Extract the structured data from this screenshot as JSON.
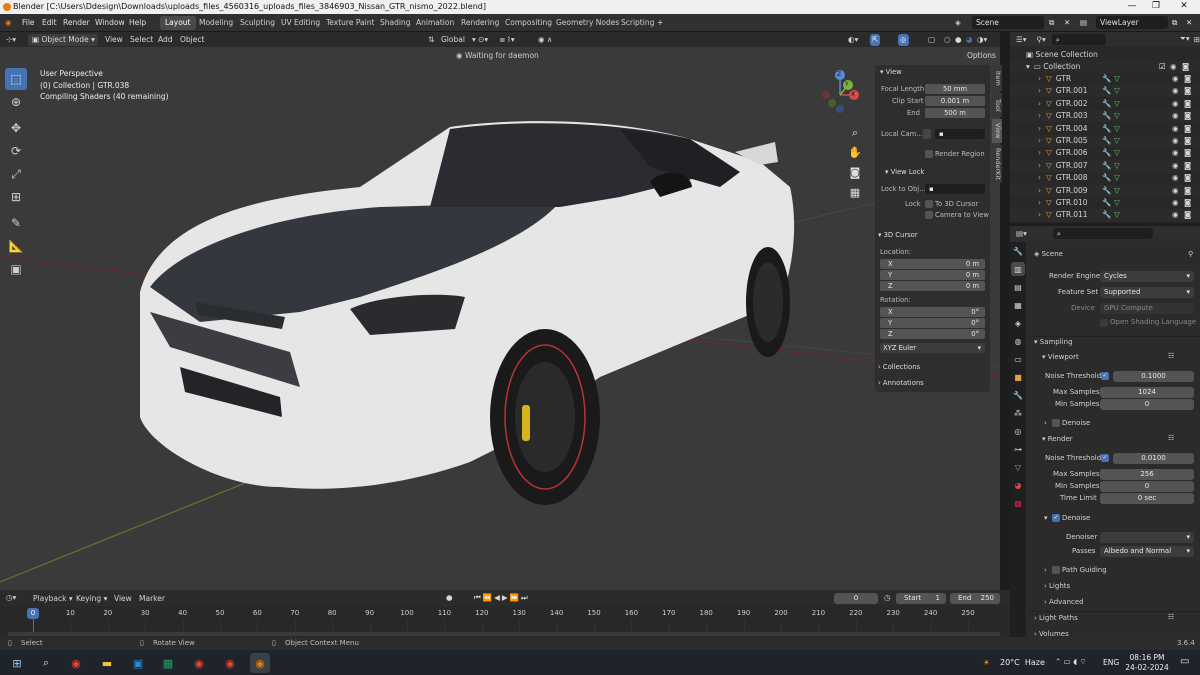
{
  "window": {
    "title": "Blender [C:\\Users\\Ddesign\\Downloads\\uploads_files_4560316_uploads_files_3846903_Nissan_GTR_nismo_2022.blend]",
    "minimize": "—",
    "maximize": "❐",
    "close": "✕"
  },
  "menu": {
    "items": [
      "File",
      "Edit",
      "Render",
      "Window",
      "Help"
    ]
  },
  "workspaces": [
    "Layout",
    "Modeling",
    "Sculpting",
    "UV Editing",
    "Texture Paint",
    "Shading",
    "Animation",
    "Rendering",
    "Compositing",
    "Geometry Nodes",
    "Scripting"
  ],
  "add_workspace": "+",
  "scene_field": "Scene",
  "viewlayer_field": "ViewLayer",
  "viewport_header": {
    "mode": "Object Mode",
    "menus": [
      "View",
      "Select",
      "Add",
      "Object"
    ],
    "orientation": "Global",
    "options": "Options",
    "status": "Waiting for daemon"
  },
  "viewport_overlay": {
    "line1": "User Perspective",
    "line2": "(0) Collection | GTR.038",
    "line3": "Compiling Shaders (40 remaining)"
  },
  "gizmo": {
    "x": "X",
    "y": "Y",
    "z": "Z"
  },
  "npanel": {
    "tabs": [
      "Item",
      "Tool",
      "View",
      "RenderKit"
    ],
    "view_title": "View",
    "focal_length_label": "Focal Length",
    "focal_length": "50 mm",
    "clip_start_label": "Clip Start",
    "clip_start": "0.001 m",
    "end_label": "End",
    "end": "500 m",
    "local_camera_label": "Local Cam...",
    "render_region": "Render Region",
    "view_lock_title": "View Lock",
    "lock_to_obj_label": "Lock to Obj...",
    "lock_label": "Lock",
    "to_3d_cursor": "To 3D Cursor",
    "camera_to_view": "Camera to View",
    "cursor_title": "3D Cursor",
    "location_label": "Location:",
    "loc": [
      {
        "axis": "X",
        "value": "0 m"
      },
      {
        "axis": "Y",
        "value": "0 m"
      },
      {
        "axis": "Z",
        "value": "0 m"
      }
    ],
    "rotation_label": "Rotation:",
    "rot": [
      {
        "axis": "X",
        "value": "0°"
      },
      {
        "axis": "Y",
        "value": "0°"
      },
      {
        "axis": "Z",
        "value": "0°"
      }
    ],
    "rotation_mode": "XYZ Euler",
    "collections": "Collections",
    "annotations": "Annotations"
  },
  "outliner": {
    "scene_collection": "Scene Collection",
    "collection": "Collection",
    "items": [
      "GTR",
      "GTR.001",
      "GTR.002",
      "GTR.003",
      "GTR.004",
      "GTR.005",
      "GTR.006",
      "GTR.007",
      "GTR.008",
      "GTR.009",
      "GTR.010",
      "GTR.011"
    ]
  },
  "properties": {
    "context": "Scene",
    "render_engine_label": "Render Engine",
    "render_engine": "Cycles",
    "feature_set_label": "Feature Set",
    "feature_set": "Supported",
    "device_label": "Device",
    "device": "GPU Compute",
    "osl": "Open Shading Language",
    "sampling": "Sampling",
    "viewport": "Viewport",
    "noise_threshold_label": "Noise Threshold",
    "vp_noise_threshold": "0.1000",
    "max_samples_label": "Max Samples",
    "vp_max_samples": "1024",
    "min_samples_label": "Min Samples",
    "vp_min_samples": "0",
    "denoise": "Denoise",
    "render": "Render",
    "r_noise_threshold": "0.0100",
    "r_max_samples": "256",
    "r_min_samples": "0",
    "time_limit_label": "Time Limit",
    "time_limit": "0 sec",
    "denoise_on": "Denoise",
    "denoiser_label": "Denoiser",
    "denoiser": "",
    "passes_label": "Passes",
    "passes": "Albedo and Normal",
    "path_guiding": "Path Guiding",
    "lights": "Lights",
    "advanced": "Advanced",
    "light_paths": "Light Paths",
    "volumes": "Volumes"
  },
  "timeline": {
    "menus": [
      "Playback",
      "Keying",
      "View",
      "Marker"
    ],
    "current_frame": "0",
    "start_label": "Start",
    "start": "1",
    "end_label": "End",
    "end": "250",
    "ticks": [
      "0",
      "10",
      "20",
      "30",
      "40",
      "50",
      "60",
      "70",
      "80",
      "90",
      "100",
      "110",
      "120",
      "130",
      "140",
      "150",
      "160",
      "170",
      "180",
      "190",
      "200",
      "210",
      "220",
      "230",
      "240",
      "250"
    ],
    "playhead": "0"
  },
  "statusbar": {
    "select": "Select",
    "rotate": "Rotate View",
    "context_menu": "Object Context Menu",
    "version": "3.6.4"
  },
  "taskbar": {
    "weather": "20°C  Haze",
    "lang": "ENG",
    "time": "08:16 PM",
    "date": "24-02-2024"
  },
  "colors": {
    "accent": "#4772b3",
    "orange": "#e87d0d",
    "mesh_green": "#66c27a",
    "viewport_bg": "#3a3a3a"
  }
}
